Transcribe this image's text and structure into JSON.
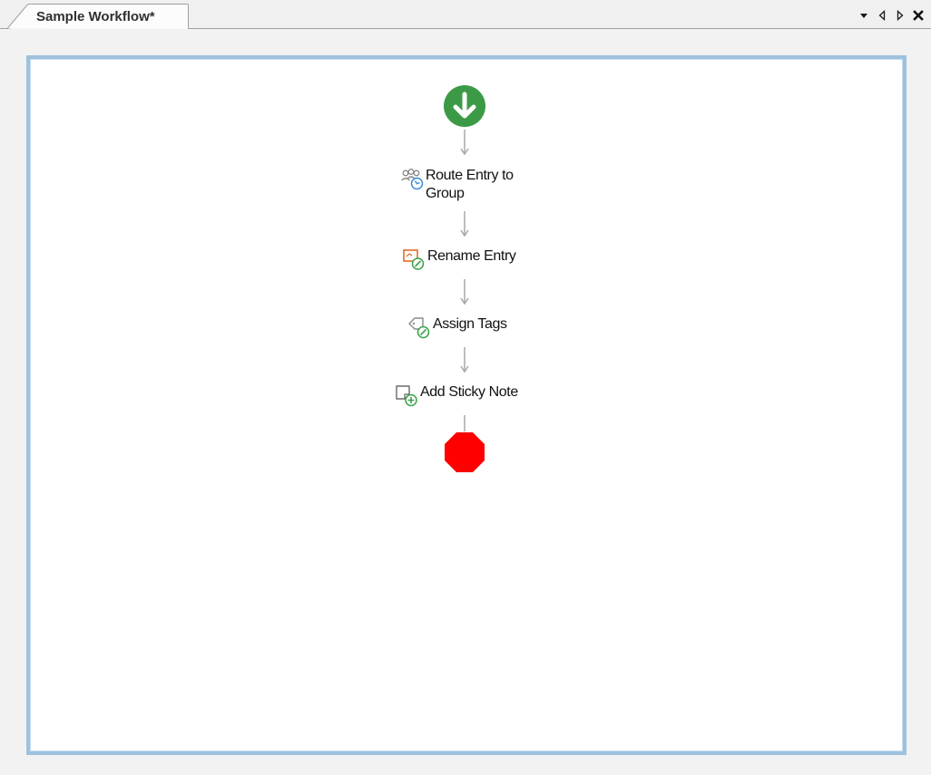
{
  "document_tab": {
    "title": "Sample Workflow*"
  },
  "tab_controls": {
    "dropdown_icon": "dropdown-triangle-icon",
    "scroll_left_icon": "scroll-left-icon",
    "scroll_right_icon": "scroll-right-icon",
    "close_icon": "close-icon"
  },
  "workflow": {
    "start_icon": "start-arrow-icon",
    "end_icon": "stop-octagon-icon",
    "start_color": "#3c9a46",
    "end_color": "#ff0000",
    "steps": [
      {
        "label_line1": "Route Entry to",
        "label_line2": "Group",
        "icon": "route-group-icon"
      },
      {
        "label_line1": "Rename Entry",
        "icon": "rename-entry-icon"
      },
      {
        "label_line1": "Assign Tags",
        "icon": "assign-tags-icon"
      },
      {
        "label_line1": "Add Sticky Note",
        "icon": "add-sticky-note-icon"
      }
    ]
  }
}
